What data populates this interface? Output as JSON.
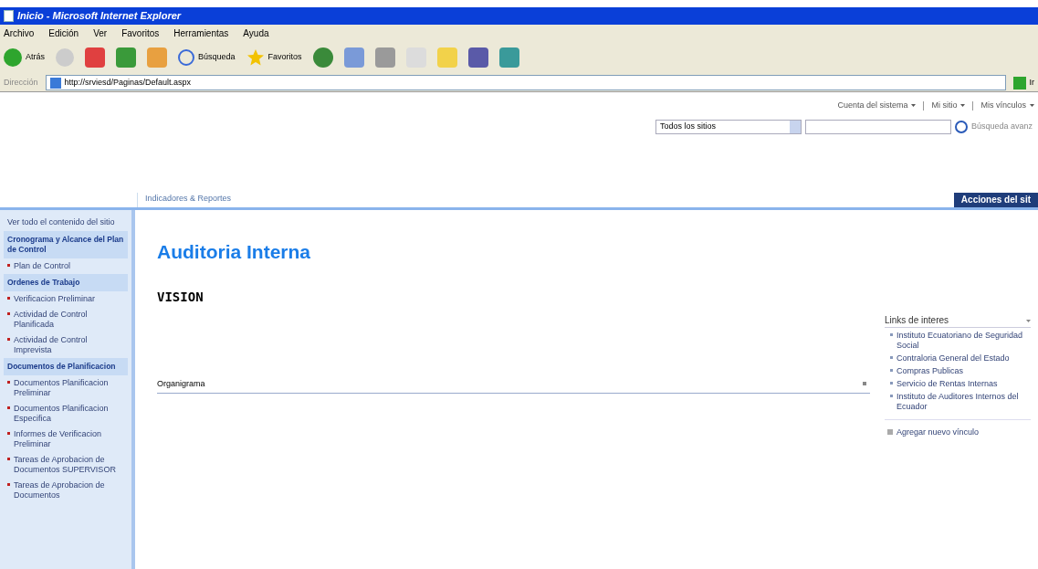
{
  "window": {
    "title": "Inicio - Microsoft Internet Explorer"
  },
  "menu": [
    "Archivo",
    "Edición",
    "Ver",
    "Favoritos",
    "Herramientas",
    "Ayuda"
  ],
  "toolbar": {
    "back": "Atrás",
    "search": "Búsqueda",
    "favorites": "Favoritos"
  },
  "address": {
    "label": "Dirección",
    "value": "http://srviesd/Paginas/Default.aspx",
    "go": "Ir"
  },
  "top_links": [
    "Cuenta del sistema",
    "Mi sitio",
    "Mis vínculos"
  ],
  "search": {
    "scope": "Todos los sitios",
    "advanced": "Búsqueda avanz"
  },
  "tabs": [
    {
      "label": "Indicadores & Reportes",
      "selected": false
    }
  ],
  "site_actions": "Acciones del sit",
  "sidebar": {
    "view_all": "Ver todo el contenido del sitio",
    "items": [
      {
        "kind": "heading",
        "label": "Cronograma y Alcance del Plan de Control"
      },
      {
        "kind": "link",
        "label": "Plan de Control"
      },
      {
        "kind": "heading",
        "label": "Ordenes de Trabajo"
      },
      {
        "kind": "link",
        "label": "Verificacion Preliminar"
      },
      {
        "kind": "link",
        "label": "Actividad de Control Planificada"
      },
      {
        "kind": "link",
        "label": "Actividad de Control Imprevista"
      },
      {
        "kind": "heading",
        "label": "Documentos de Planificacion"
      },
      {
        "kind": "link",
        "label": "Documentos Planificacion Preliminar"
      },
      {
        "kind": "link",
        "label": "Documentos Planificacion Especifica"
      },
      {
        "kind": "link",
        "label": "Informes de Verificacion Preliminar"
      },
      {
        "kind": "link",
        "label": "Tareas de Aprobacion de Documentos SUPERVISOR"
      },
      {
        "kind": "link",
        "label": "Tareas de Aprobacion de Documentos"
      }
    ]
  },
  "page_title": "Auditoria Interna",
  "heading": "VISION",
  "web_part": {
    "title": "Organigrama"
  },
  "links_panel": {
    "title": "Links de interes",
    "links": [
      "Instituto Ecuatoriano de Seguridad Social",
      "Contraloria General del Estado",
      "Compras Publicas",
      "Servicio de Rentas Internas",
      "Instituto de Auditores Internos del Ecuador"
    ],
    "add": "Agregar nuevo vínculo"
  }
}
